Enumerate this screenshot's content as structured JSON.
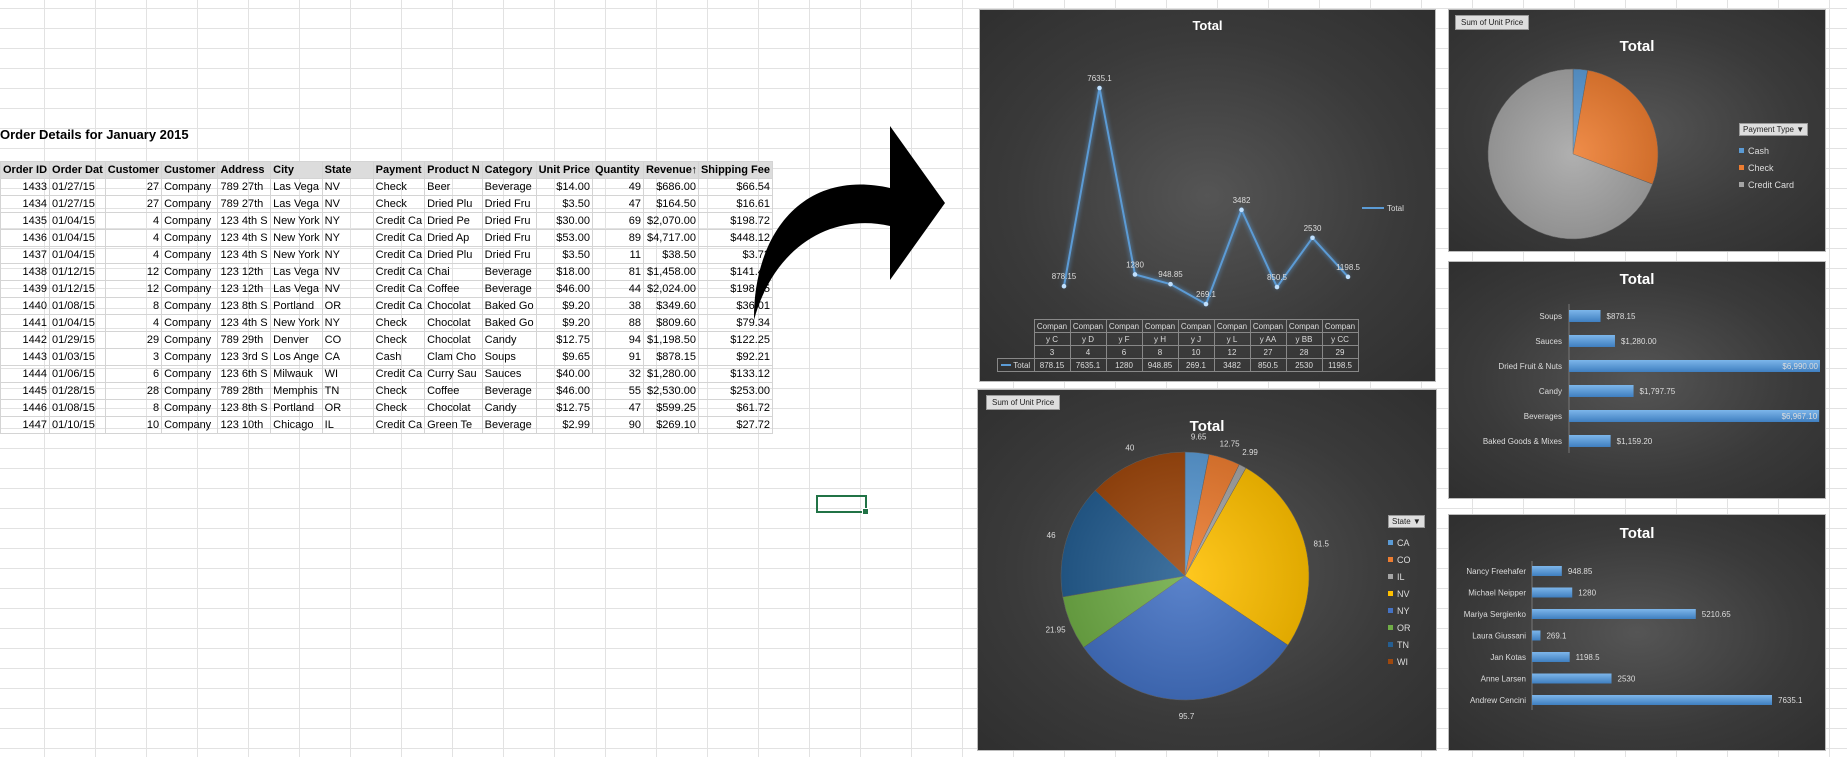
{
  "sheet": {
    "title": "Order Details for January 2015",
    "columns": [
      "Order ID",
      "Order Dat",
      "Customer",
      "Customer",
      "Address",
      "City",
      "State",
      "Payment",
      "Product N",
      "Category",
      "Unit Price",
      "Quantity",
      "Revenue",
      "Shipping Fee"
    ],
    "rows": [
      [
        "1433",
        "01/27/15",
        "27",
        "Company",
        "789 27th",
        "Las Vega",
        "NV",
        "Check",
        "Beer",
        "Beverage",
        "$14.00",
        "49",
        "$686.00",
        "$66.54"
      ],
      [
        "1434",
        "01/27/15",
        "27",
        "Company",
        "789 27th",
        "Las Vega",
        "NV",
        "Check",
        "Dried Plu",
        "Dried Fru",
        "$3.50",
        "47",
        "$164.50",
        "$16.61"
      ],
      [
        "1435",
        "01/04/15",
        "4",
        "Company",
        "123 4th S",
        "New York",
        "NY",
        "Credit Ca",
        "Dried Pe",
        "Dried Fru",
        "$30.00",
        "69",
        "$2,070.00",
        "$198.72"
      ],
      [
        "1436",
        "01/04/15",
        "4",
        "Company",
        "123 4th S",
        "New York",
        "NY",
        "Credit Ca",
        "Dried Ap",
        "Dried Fru",
        "$53.00",
        "89",
        "$4,717.00",
        "$448.12"
      ],
      [
        "1437",
        "01/04/15",
        "4",
        "Company",
        "123 4th S",
        "New York",
        "NY",
        "Credit Ca",
        "Dried Plu",
        "Dried Fru",
        "$3.50",
        "11",
        "$38.50",
        "$3.73"
      ],
      [
        "1438",
        "01/12/15",
        "12",
        "Company",
        "123 12th",
        "Las Vega",
        "NV",
        "Credit Ca",
        "Chai",
        "Beverage",
        "$18.00",
        "81",
        "$1,458.00",
        "$141.43"
      ],
      [
        "1439",
        "01/12/15",
        "12",
        "Company",
        "123 12th",
        "Las Vega",
        "NV",
        "Credit Ca",
        "Coffee",
        "Beverage",
        "$46.00",
        "44",
        "$2,024.00",
        "$198.35"
      ],
      [
        "1440",
        "01/08/15",
        "8",
        "Company",
        "123 8th S",
        "Portland",
        "OR",
        "Credit Ca",
        "Chocolat",
        "Baked Go",
        "$9.20",
        "38",
        "$349.60",
        "$36.01"
      ],
      [
        "1441",
        "01/04/15",
        "4",
        "Company",
        "123 4th S",
        "New York",
        "NY",
        "Check",
        "Chocolat",
        "Baked Go",
        "$9.20",
        "88",
        "$809.60",
        "$79.34"
      ],
      [
        "1442",
        "01/29/15",
        "29",
        "Company",
        "789 29th",
        "Denver",
        "CO",
        "Check",
        "Chocolat",
        "Candy",
        "$12.75",
        "94",
        "$1,198.50",
        "$122.25"
      ],
      [
        "1443",
        "01/03/15",
        "3",
        "Company",
        "123 3rd S",
        "Los Ange",
        "CA",
        "Cash",
        "Clam Cho",
        "Soups",
        "$9.65",
        "91",
        "$878.15",
        "$92.21"
      ],
      [
        "1444",
        "01/06/15",
        "6",
        "Company",
        "123 6th S",
        "Milwauk",
        "WI",
        "Credit Ca",
        "Curry Sau",
        "Sauces",
        "$40.00",
        "32",
        "$1,280.00",
        "$133.12"
      ],
      [
        "1445",
        "01/28/15",
        "28",
        "Company",
        "789 28th",
        "Memphis",
        "TN",
        "Check",
        "Coffee",
        "Beverage",
        "$46.00",
        "55",
        "$2,530.00",
        "$253.00"
      ],
      [
        "1446",
        "01/08/15",
        "8",
        "Company",
        "123 8th S",
        "Portland",
        "OR",
        "Check",
        "Chocolat",
        "Candy",
        "$12.75",
        "47",
        "$599.25",
        "$61.72"
      ],
      [
        "1447",
        "01/10/15",
        "10",
        "Company",
        "123 10th",
        "Chicago",
        "IL",
        "Credit Ca",
        "Green Te",
        "Beverage",
        "$2.99",
        "90",
        "$269.10",
        "$27.72"
      ]
    ],
    "col_align": [
      "num",
      "left",
      "num",
      "left",
      "left",
      "left",
      "left",
      "left",
      "left",
      "left",
      "num",
      "num",
      "num",
      "num"
    ]
  },
  "icons": {
    "arrow": "curved-arrow-right-icon",
    "sort": "sort-ascending-icon"
  },
  "colors": {
    "line": "#5b9bd5",
    "chart_bg": "#3a3a3a",
    "excel_green": "#217346"
  },
  "chart_data": [
    {
      "id": "line",
      "type": "line",
      "title": "Total",
      "categories": [
        "Company C 3",
        "Company D 4",
        "Company F 6",
        "Company H 8",
        "Company J 10",
        "Company L 12",
        "Company AA 27",
        "Company BB 28",
        "Company CC 29"
      ],
      "table_row1": [
        "Compan",
        "Compan",
        "Compan",
        "Compan",
        "Compan",
        "Compan",
        "Compan",
        "Compan",
        "Compan"
      ],
      "table_row2": [
        "y C",
        "y D",
        "y F",
        "y H",
        "y J",
        "y L",
        "y AA",
        "y BB",
        "y CC"
      ],
      "table_row3": [
        "3",
        "4",
        "6",
        "8",
        "10",
        "12",
        "27",
        "28",
        "29"
      ],
      "series": [
        {
          "name": "Total",
          "values": [
            878.15,
            7635.1,
            1280,
            948.85,
            269.1,
            3482,
            850.5,
            2530,
            1198.5
          ]
        }
      ],
      "value_labels": [
        "878.15",
        "7635.1",
        "1280",
        "948.85",
        "269.1",
        "3482",
        "850.5",
        "2530",
        "1198.5"
      ],
      "ylim": [
        0,
        8000
      ],
      "legend": "right"
    },
    {
      "id": "pie-payment",
      "type": "pie",
      "title": "Total",
      "field_button": "Sum of Unit Price",
      "legend_title": "Payment Type",
      "categories": [
        "Cash",
        "Check",
        "Credit Card"
      ],
      "values": [
        9.65,
        98.25,
        242.69
      ],
      "colors": [
        "#5b9bd5",
        "#ed7d31",
        "#a5a5a5"
      ],
      "legend": "right"
    },
    {
      "id": "pie-state",
      "type": "pie",
      "title": "Total",
      "field_button": "Sum of Unit Price",
      "legend_title": "State",
      "categories": [
        "CA",
        "CO",
        "IL",
        "NV",
        "NY",
        "OR",
        "TN",
        "WI"
      ],
      "values": [
        9.65,
        12.75,
        2.99,
        81.5,
        95.7,
        21.95,
        46,
        40
      ],
      "labels": [
        "9.65",
        "12.75",
        "2.99",
        "81.5",
        "95.7",
        "21.95",
        "46",
        "40"
      ],
      "colors": [
        "#5b9bd5",
        "#ed7d31",
        "#a5a5a5",
        "#ffc000",
        "#4472c4",
        "#70ad47",
        "#255e91",
        "#9e480e"
      ],
      "legend": "right"
    },
    {
      "id": "bar-category",
      "type": "bar",
      "title": "Total",
      "categories": [
        "Soups",
        "Sauces",
        "Dried Fruit & Nuts",
        "Candy",
        "Beverages",
        "Baked Goods & Mixes"
      ],
      "values": [
        878.15,
        1280,
        6990,
        1797.75,
        6967.1,
        1159.2
      ],
      "labels": [
        "$878.15",
        "$1,280.00",
        "$6,990.00",
        "$1,797.75",
        "$6,967.10",
        "$1,159.20"
      ]
    },
    {
      "id": "bar-employee",
      "type": "bar",
      "title": "Total",
      "categories": [
        "Nancy Freehafer",
        "Michael Neipper",
        "Mariya Sergienko",
        "Laura Giussani",
        "Jan Kotas",
        "Anne Larsen",
        "Andrew Cencini"
      ],
      "values": [
        948.85,
        1280,
        5210.65,
        269.1,
        1198.5,
        2530,
        7635.1
      ],
      "labels": [
        "948.85",
        "1280",
        "5210.65",
        "269.1",
        "1198.5",
        "2530",
        "7635.1"
      ]
    }
  ]
}
